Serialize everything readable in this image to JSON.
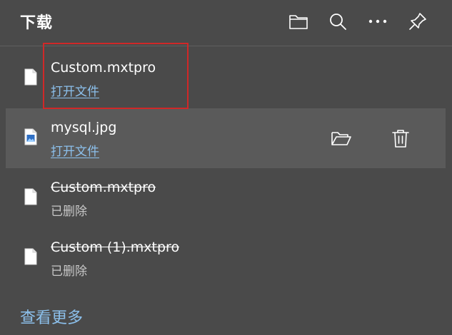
{
  "header": {
    "title": "下载"
  },
  "downloads": [
    {
      "name": "Custom.mxtpro",
      "action": "打开文件",
      "status": "",
      "icon": "file-icon"
    },
    {
      "name": "mysql.jpg",
      "action": "打开文件",
      "status": "",
      "icon": "image-file-icon"
    },
    {
      "name": "Custom.mxtpro",
      "action": "",
      "status": "已删除",
      "icon": "file-icon"
    },
    {
      "name": "Custom (1).mxtpro",
      "action": "",
      "status": "已删除",
      "icon": "file-icon"
    }
  ],
  "footer": {
    "see_more": "查看更多"
  },
  "colors": {
    "background": "#4a4a4a",
    "hover_row": "#5a5a5a",
    "link": "#8cc0ec",
    "highlight_border": "#d02828"
  }
}
